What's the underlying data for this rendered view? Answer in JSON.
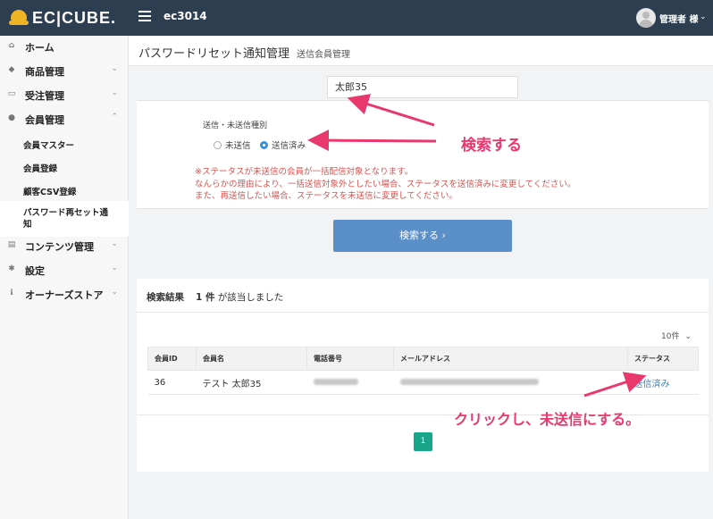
{
  "header": {
    "logo_text": "EC|CUBE.",
    "shop_name": "ec3014",
    "user_name": "管理者 様"
  },
  "sidebar": {
    "items": [
      {
        "label": "ホーム",
        "icon": "home-icon"
      },
      {
        "label": "商品管理",
        "icon": "tag-icon"
      },
      {
        "label": "受注管理",
        "icon": "cart-icon"
      },
      {
        "label": "会員管理",
        "icon": "users-icon"
      },
      {
        "label": "コンテンツ管理",
        "icon": "file-icon"
      },
      {
        "label": "設定",
        "icon": "gear-icon"
      },
      {
        "label": "オーナーズストア",
        "icon": "info-icon"
      }
    ],
    "member_subitems": [
      "会員マスター",
      "会員登録",
      "顧客CSV登録",
      "パスワード再セット通知"
    ]
  },
  "page": {
    "title": "パスワードリセット通知管理",
    "subtitle": "送信会員管理"
  },
  "search": {
    "keyword": "太郎35",
    "filter_label": "送信・未送信種別",
    "options": [
      "未送信",
      "送信済み"
    ],
    "selected": "送信済み",
    "notes": [
      "※ステータスが未送信の会員が一括配信対象となります。",
      "なんらかの理由により、一括送信対象外としたい場合、ステータスを送信済みに変更してください。",
      "また、再送信したい場合、ステータスを未送信に変更してください。"
    ],
    "button_label": "検索する ›"
  },
  "results": {
    "label": "検索結果",
    "count_text": "1 件",
    "count_suffix": "が該当しました",
    "per_page": "10件",
    "columns": [
      "会員ID",
      "会員名",
      "電話番号",
      "メールアドレス",
      "ステータス"
    ],
    "rows": [
      {
        "id": "36",
        "name": "テスト 太郎35",
        "status": "送信済み"
      }
    ],
    "current_page": "1"
  },
  "annotations": {
    "search": "検索する",
    "click": "クリックし、未送信にする。"
  },
  "colors": {
    "header_bg": "#2c3e50",
    "primary_button": "#5b8fc7",
    "pagination_active": "#18a58a",
    "annotation": "#e8386d",
    "note_text": "#d9534f",
    "link": "#3b82c4"
  }
}
